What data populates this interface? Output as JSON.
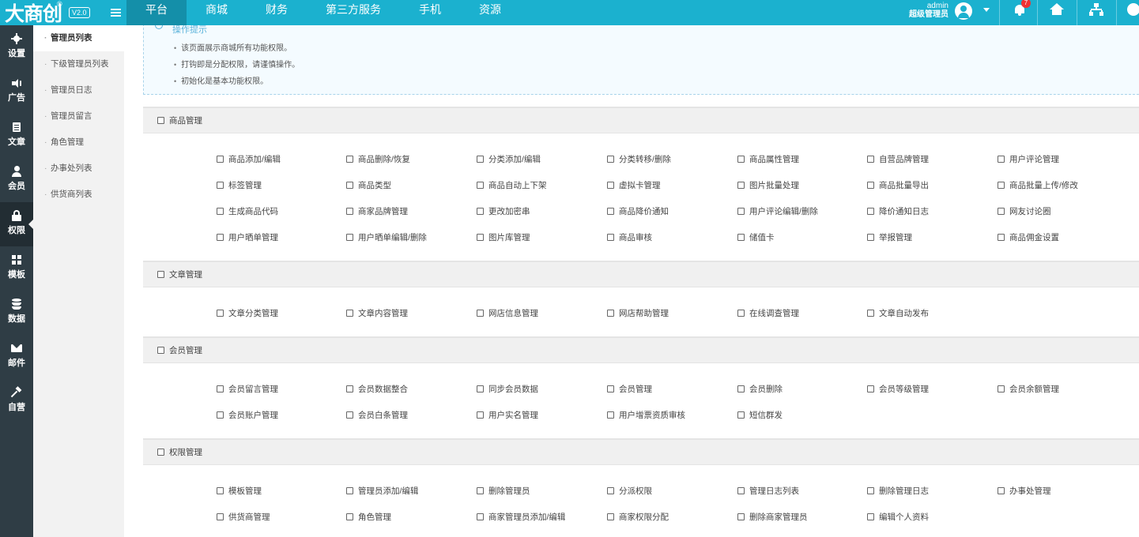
{
  "logo": {
    "brand": "大商创",
    "reg": "®",
    "version": "V2.0"
  },
  "topnav": {
    "items": [
      "平台",
      "商城",
      "财务",
      "第三方服务",
      "手机",
      "资源"
    ],
    "active": 0
  },
  "user": {
    "name": "admin",
    "role": "超级管理员"
  },
  "notifications": {
    "count": "7"
  },
  "leftbar": {
    "items": [
      {
        "label": "设置",
        "icon": "gear-icon"
      },
      {
        "label": "广告",
        "icon": "speaker-icon"
      },
      {
        "label": "文章",
        "icon": "document-icon"
      },
      {
        "label": "会员",
        "icon": "user-icon"
      },
      {
        "label": "权限",
        "icon": "lock-icon"
      },
      {
        "label": "模板",
        "icon": "template-icon"
      },
      {
        "label": "数据",
        "icon": "database-icon"
      },
      {
        "label": "邮件",
        "icon": "mail-icon"
      },
      {
        "label": "自营",
        "icon": "hammer-icon"
      }
    ],
    "active": 4
  },
  "submenu": {
    "items": [
      "管理员列表",
      "下级管理员列表",
      "管理员日志",
      "管理员留言",
      "角色管理",
      "办事处列表",
      "供货商列表"
    ],
    "active": 0
  },
  "tips": {
    "title": "操作提示",
    "items": [
      "该页面展示商城所有功能权限。",
      "打钩即是分配权限，请谨慎操作。",
      "初始化是基本功能权限。"
    ]
  },
  "sections": [
    {
      "title": "商品管理",
      "perms": [
        "商品添加/编辑",
        "商品删除/恢复",
        "分类添加/编辑",
        "分类转移/删除",
        "商品属性管理",
        "自营品牌管理",
        "用户评论管理",
        "标签管理",
        "商品类型",
        "商品自动上下架",
        "虚拟卡管理",
        "图片批量处理",
        "商品批量导出",
        "商品批量上传/修改",
        "生成商品代码",
        "商家品牌管理",
        "更改加密串",
        "商品降价通知",
        "用户评论编辑/删除",
        "降价通知日志",
        "网友讨论圈",
        "用户晒单管理",
        "用户晒单编辑/删除",
        "图片库管理",
        "商品审核",
        "储值卡",
        "举报管理",
        "商品佣金设置"
      ]
    },
    {
      "title": "文章管理",
      "perms": [
        "文章分类管理",
        "文章内容管理",
        "网店信息管理",
        "网店帮助管理",
        "在线调查管理",
        "文章自动发布"
      ]
    },
    {
      "title": "会员管理",
      "perms": [
        "会员留言管理",
        "会员数据整合",
        "同步会员数据",
        "会员管理",
        "会员删除",
        "会员等级管理",
        "会员余额管理",
        "会员账户管理",
        "会员白条管理",
        "用户实名管理",
        "用户增票资质审核",
        "短信群发"
      ]
    },
    {
      "title": "权限管理",
      "perms": [
        "模板管理",
        "管理员添加/编辑",
        "删除管理员",
        "分派权限",
        "管理日志列表",
        "删除管理日志",
        "办事处管理",
        "供货商管理",
        "角色管理",
        "商家管理员添加/编辑",
        "商家权限分配",
        "删除商家管理员",
        "编辑个人资料"
      ]
    }
  ]
}
